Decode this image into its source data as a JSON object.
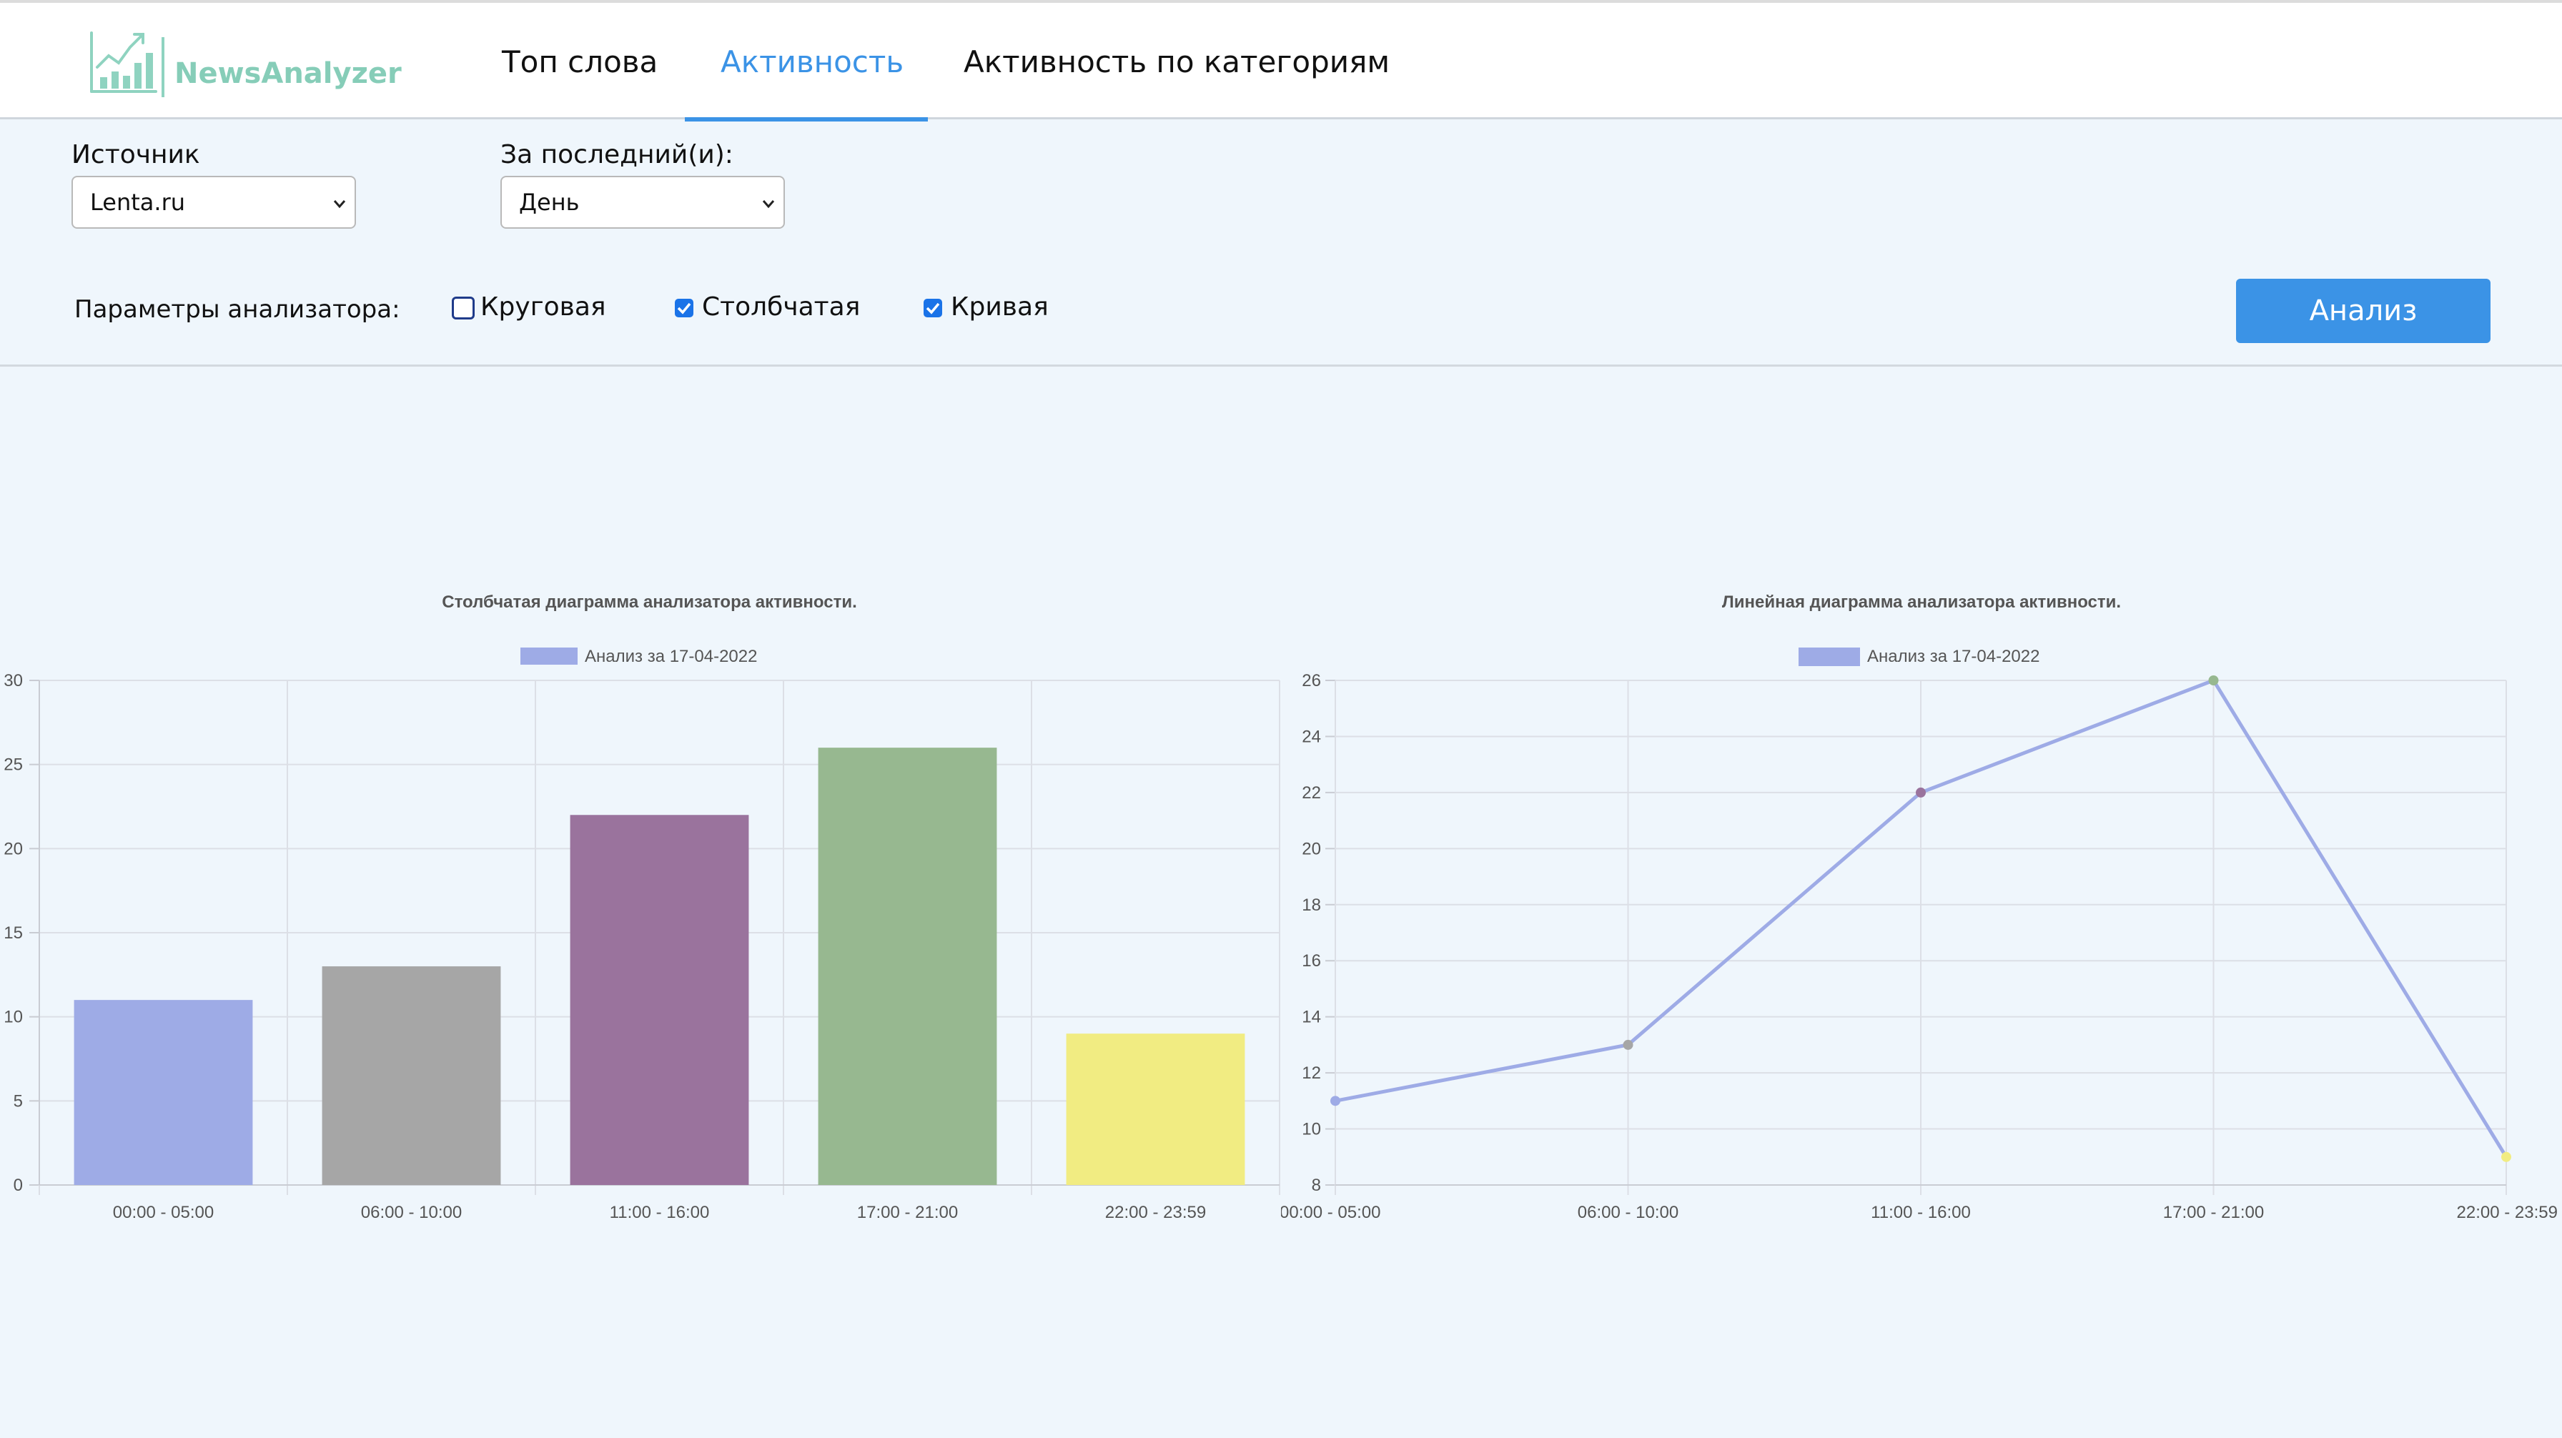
{
  "header": {
    "logo_text": "NewsAnalyzer",
    "tabs": [
      {
        "label": "Топ слова"
      },
      {
        "label": "Активность",
        "active": true
      },
      {
        "label": "Активность по категориям"
      }
    ],
    "accent_color": "#3b93e6"
  },
  "filters": {
    "source_label": "Источник",
    "source_value": "Lenta.ru",
    "period_label": "За последний(и):",
    "period_value": "День"
  },
  "params": {
    "label": "Параметры анализатора:",
    "options": [
      {
        "label": "Круговая",
        "checked": false
      },
      {
        "label": "Столбчатая",
        "checked": true
      },
      {
        "label": "Кривая",
        "checked": true
      }
    ],
    "analyze_button": "Анализ"
  },
  "chart_data": [
    {
      "type": "bar",
      "title": "Столбчатая диаграмма анализатора активности.",
      "legend": "Анализ за 17-04-2022",
      "categories": [
        "00:00 - 05:00",
        "06:00 - 10:00",
        "11:00 - 16:00",
        "17:00 - 21:00",
        "22:00 - 23:59"
      ],
      "values": [
        11,
        13,
        22,
        26,
        9
      ],
      "colors": [
        "#9eabe6",
        "#a6a6a6",
        "#9a739d",
        "#97b890",
        "#f1ec82"
      ],
      "ylim": [
        0,
        30
      ],
      "yticks": [
        0,
        5,
        10,
        15,
        20,
        25,
        30
      ],
      "legend_color": "#9eabe6",
      "grid": true
    },
    {
      "type": "line",
      "title": "Линейная диаграмма анализатора активности.",
      "legend": "Анализ за 17-04-2022",
      "categories": [
        "00:00 - 05:00",
        "06:00 - 10:00",
        "11:00 - 16:00",
        "17:00 - 21:00",
        "22:00 - 23:59"
      ],
      "values": [
        11,
        13,
        22,
        26,
        9
      ],
      "point_colors": [
        "#9eabe6",
        "#a6a6a6",
        "#9a739d",
        "#97b890",
        "#f1ec82"
      ],
      "line_color": "#9eabe6",
      "ylim": [
        8,
        26
      ],
      "yticks": [
        8,
        10,
        12,
        14,
        16,
        18,
        20,
        22,
        24,
        26
      ],
      "legend_color": "#9eabe6",
      "grid": true
    }
  ]
}
